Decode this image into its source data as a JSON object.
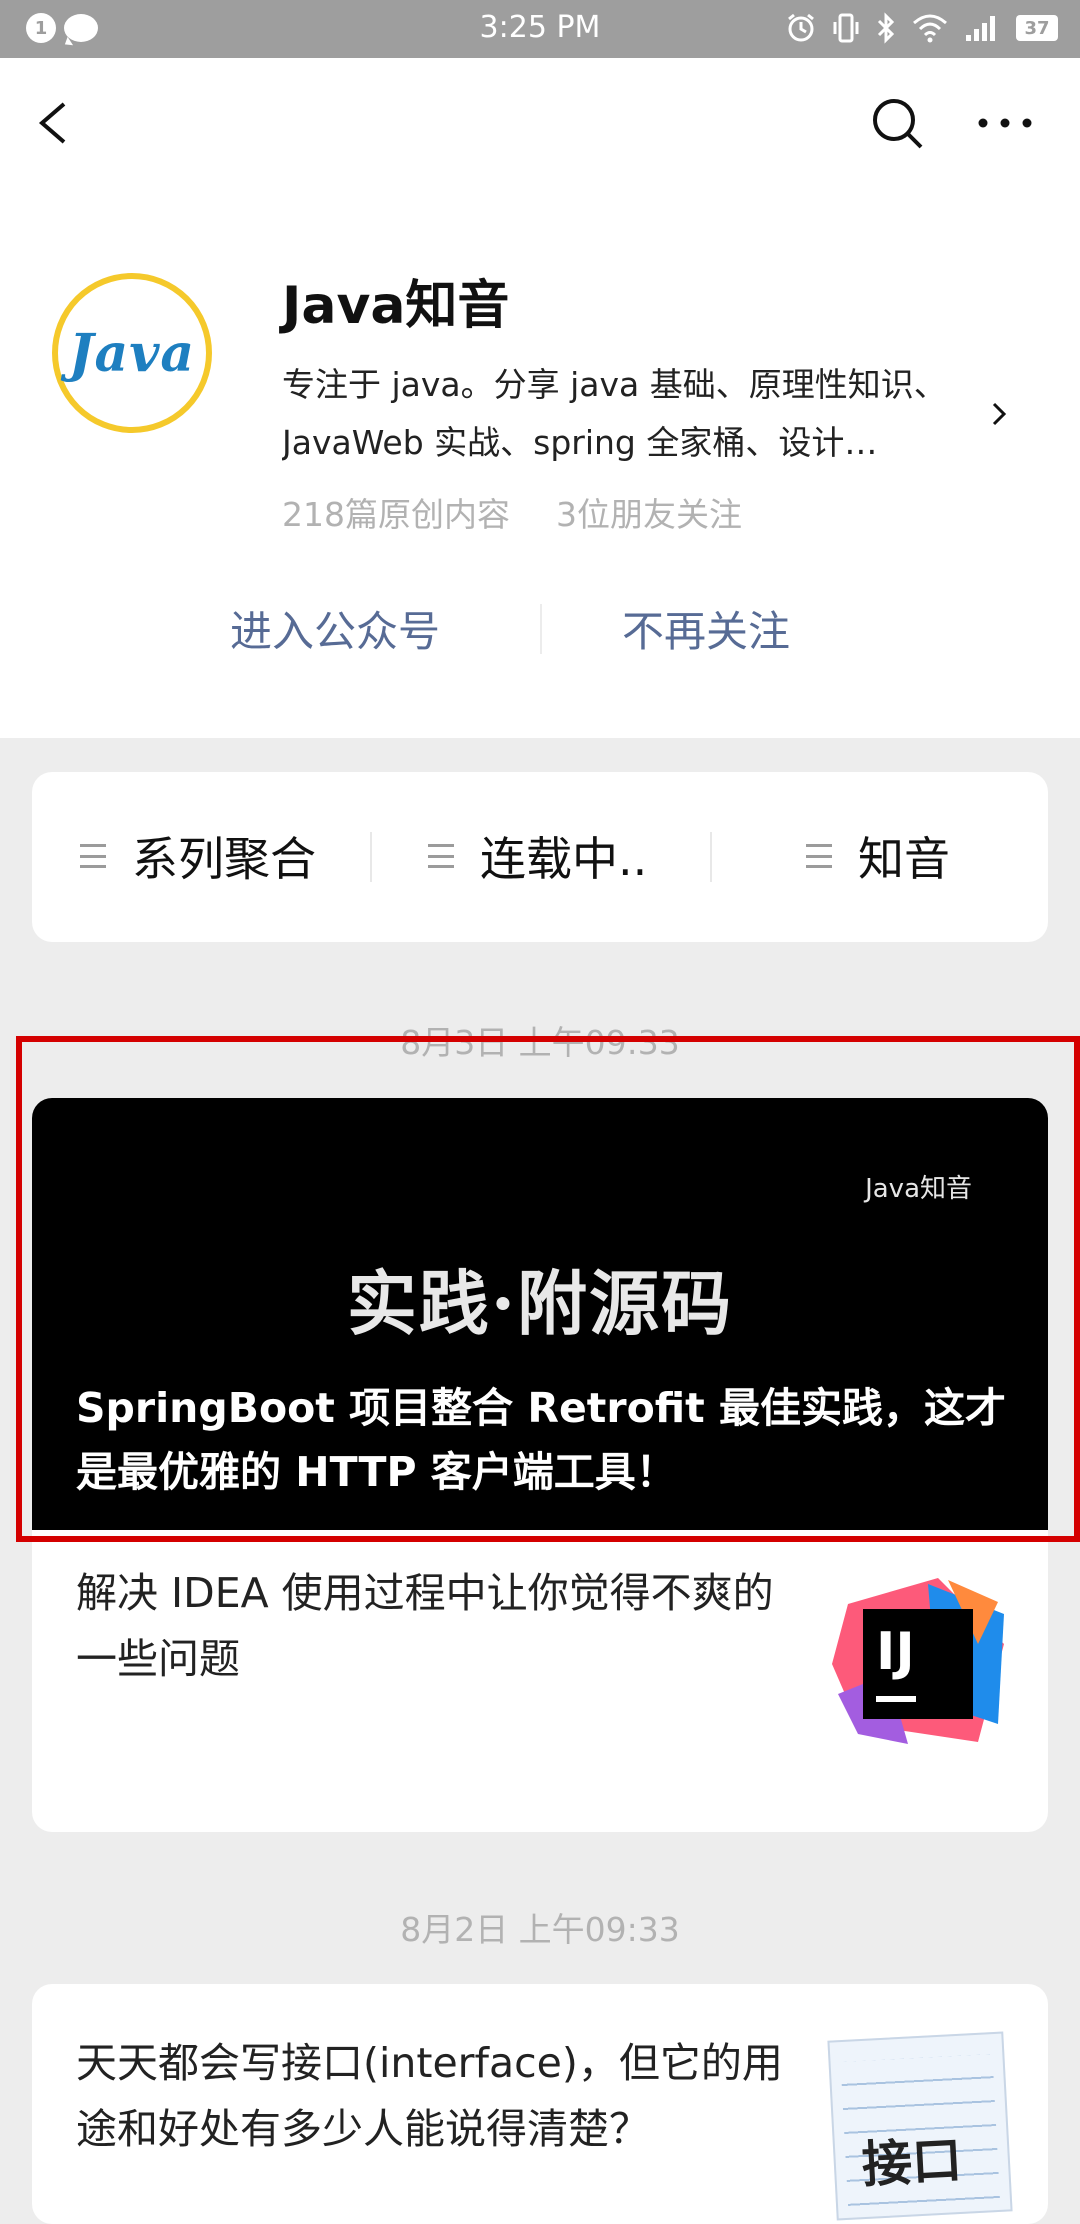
{
  "status_bar": {
    "notification_count": "1",
    "time": "3:25 PM",
    "battery": "37"
  },
  "account": {
    "logo_text": "Java",
    "name": "Java知音",
    "description_line1": "专注于 java。分享 java 基础、原理性知识、",
    "description_line2": "JavaWeb 实战、spring 全家桶、设计…",
    "original_count": "218篇原创内容",
    "friends_following": "3位朋友关注",
    "enter_label": "进入公众号",
    "unfollow_label": "不再关注"
  },
  "menu": {
    "items": [
      {
        "label": "系列聚合"
      },
      {
        "label": "连载中.."
      },
      {
        "label": "知音"
      }
    ]
  },
  "feed": {
    "groups": [
      {
        "date": "8月3日 上午09:33",
        "cover_brand": "Java知音",
        "cover_headline": "实践·附源码",
        "cover_title": "SpringBoot 项目整合 Retrofit 最佳实践，这才是最优雅的 HTTP 客户端工具！",
        "sub_title": "解决 IDEA 使用过程中让你觉得不爽的一些问题",
        "sub_thumb_text": "IJ"
      },
      {
        "date": "8月2日 上午09:33",
        "title": "天天都会写接口(interface)，但它的用途和好处有多少人能说得清楚？",
        "thumb_text": "接口"
      }
    ]
  },
  "colors": {
    "link_blue": "#576b95",
    "highlight_red": "#d40000",
    "logo_ring": "#f5c92b",
    "logo_text": "#1e7fc0"
  }
}
